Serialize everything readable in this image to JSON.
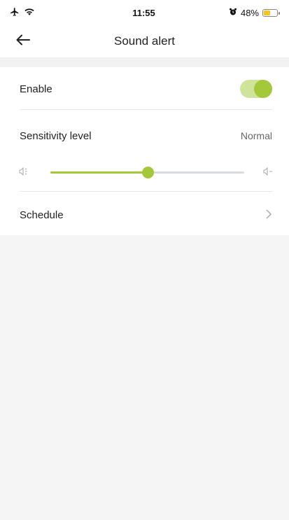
{
  "status_bar": {
    "time": "11:55",
    "battery": "48%",
    "battery_level": 0.48,
    "icons": [
      "airplane-icon",
      "wifi-icon",
      "alarm-icon",
      "battery-icon"
    ]
  },
  "header": {
    "title": "Sound alert",
    "back_icon": "back-arrow-icon"
  },
  "settings": {
    "enable": {
      "label": "Enable",
      "on": true
    },
    "sensitivity": {
      "label": "Sensitivity level",
      "value": "Normal",
      "level": 0.5
    },
    "schedule": {
      "label": "Schedule"
    }
  },
  "colors": {
    "accent": "#a3c93a",
    "accent_light": "#cfe39b",
    "track": "#d8dde2",
    "background": "#f5f5f5"
  }
}
